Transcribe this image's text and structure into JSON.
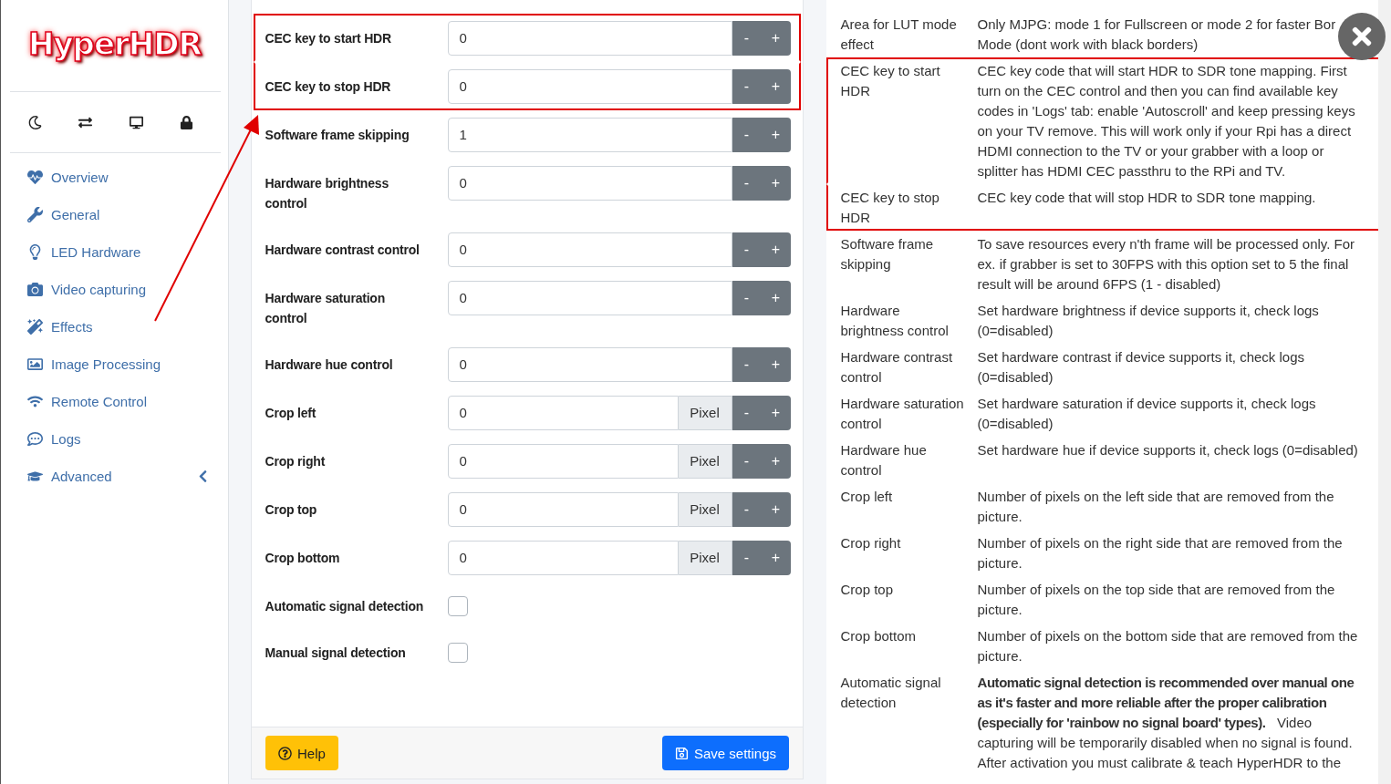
{
  "sidebar": {
    "logo": "HyperHDR",
    "items": [
      {
        "label": "Overview",
        "kind": "link"
      },
      {
        "label": "General",
        "kind": "link"
      },
      {
        "label": "LED Hardware",
        "kind": "link"
      },
      {
        "label": "Video capturing",
        "kind": "link"
      },
      {
        "label": "Effects",
        "kind": "link"
      },
      {
        "label": "Image Processing",
        "kind": "link"
      },
      {
        "label": "Remote Control",
        "kind": "link"
      },
      {
        "label": "Logs",
        "kind": "link"
      },
      {
        "label": "Advanced",
        "kind": "group",
        "expanded": false
      }
    ]
  },
  "form": {
    "rows": [
      {
        "label": "CEC key to start HDR",
        "kind": "number",
        "value": "0",
        "decrement": "-",
        "increment": "+",
        "highlighted": true
      },
      {
        "label": "CEC key to stop HDR",
        "kind": "number",
        "value": "0",
        "decrement": "-",
        "increment": "+",
        "highlighted": true
      },
      {
        "label": "Software frame skipping",
        "kind": "number",
        "value": "1",
        "decrement": "-",
        "increment": "+",
        "highlighted": false
      },
      {
        "label": "Hardware brightness control",
        "kind": "number",
        "value": "0",
        "decrement": "-",
        "increment": "+",
        "highlighted": false
      },
      {
        "label": "Hardware contrast control",
        "kind": "number",
        "value": "0",
        "decrement": "-",
        "increment": "+",
        "highlighted": false
      },
      {
        "label": "Hardware saturation control",
        "kind": "number",
        "value": "0",
        "decrement": "-",
        "increment": "+",
        "highlighted": false
      },
      {
        "label": "Hardware hue control",
        "kind": "number",
        "value": "0",
        "decrement": "-",
        "increment": "+",
        "highlighted": false
      },
      {
        "label": "Crop left",
        "kind": "number",
        "value": "0",
        "unit": "Pixel",
        "decrement": "-",
        "increment": "+",
        "highlighted": false
      },
      {
        "label": "Crop right",
        "kind": "number",
        "value": "0",
        "unit": "Pixel",
        "decrement": "-",
        "increment": "+",
        "highlighted": false
      },
      {
        "label": "Crop top",
        "kind": "number",
        "value": "0",
        "unit": "Pixel",
        "decrement": "-",
        "increment": "+",
        "highlighted": false
      },
      {
        "label": "Crop bottom",
        "kind": "number",
        "value": "0",
        "unit": "Pixel",
        "decrement": "-",
        "increment": "+",
        "highlighted": false
      },
      {
        "label": "Automatic signal detection",
        "kind": "checkbox",
        "checked": false,
        "highlighted": false
      },
      {
        "label": "Manual signal detection",
        "kind": "checkbox",
        "checked": false,
        "highlighted": false
      }
    ],
    "buttons": [
      {
        "label": "Help",
        "kind": "help"
      },
      {
        "label": "Save settings",
        "kind": "save"
      }
    ]
  },
  "help": {
    "rows": [
      {
        "term": "Area for LUT mode effect",
        "lines": [
          "Only MJPG: mode 1 for Fullscreen or mode 2 for faster Bor",
          "Mode (dont work with black borders)"
        ],
        "highlighted": false
      },
      {
        "term": "CEC key to start HDR",
        "description": "CEC key code that will start HDR to SDR tone mapping. First turn on the CEC control and then you can find available key codes in 'Logs' tab: enable 'Autoscroll' and keep pressing keys on your TV remove. This will work only if your Rpi has a direct HDMI connection to the TV or your grabber with a loop or splitter has HDMI CEC passthru to the RPi and TV.",
        "highlighted": true
      },
      {
        "term": "CEC key to stop HDR",
        "description": "CEC key code that will stop HDR to SDR tone mapping.",
        "highlighted": true
      },
      {
        "term": "Software frame skipping",
        "description": "To save resources every n'th frame will be processed only. For ex. if grabber is set to 30FPS with this option set to 5 the final result will be around 6FPS (1 - disabled)",
        "highlighted": false
      },
      {
        "term": "Hardware brightness control",
        "description": "Set hardware brightness if device supports it, check logs (0=disabled)",
        "highlighted": false
      },
      {
        "term": "Hardware contrast control",
        "description": "Set hardware contrast if device supports it, check logs (0=disabled)",
        "highlighted": false
      },
      {
        "term": "Hardware saturation control",
        "description": "Set hardware saturation if device supports it, check logs (0=disabled)",
        "highlighted": false
      },
      {
        "term": "Hardware hue control",
        "description": "Set hardware hue if device supports it, check logs (0=disabled)",
        "highlighted": false
      },
      {
        "term": "Crop left",
        "description": "Number of pixels on the left side that are removed from the picture.",
        "highlighted": false
      },
      {
        "term": "Crop right",
        "description": "Number of pixels on the right side that are removed from the picture.",
        "highlighted": false
      },
      {
        "term": "Crop top",
        "description": "Number of pixels on the top side that are removed from the picture.",
        "highlighted": false
      },
      {
        "term": "Crop bottom",
        "description": "Number of pixels on the bottom side that are removed from the picture.",
        "highlighted": false
      },
      {
        "term": "Automatic signal detection",
        "description": "**Automatic signal detection is recommended over manual one as it's faster and more reliable after the proper calibration (especially for 'rainbow no signal board' types).**   Video capturing will be temporarily disabled when no signal is found. After activation you must calibrate & teach HyperHDR to the",
        "highlighted": false
      }
    ]
  }
}
